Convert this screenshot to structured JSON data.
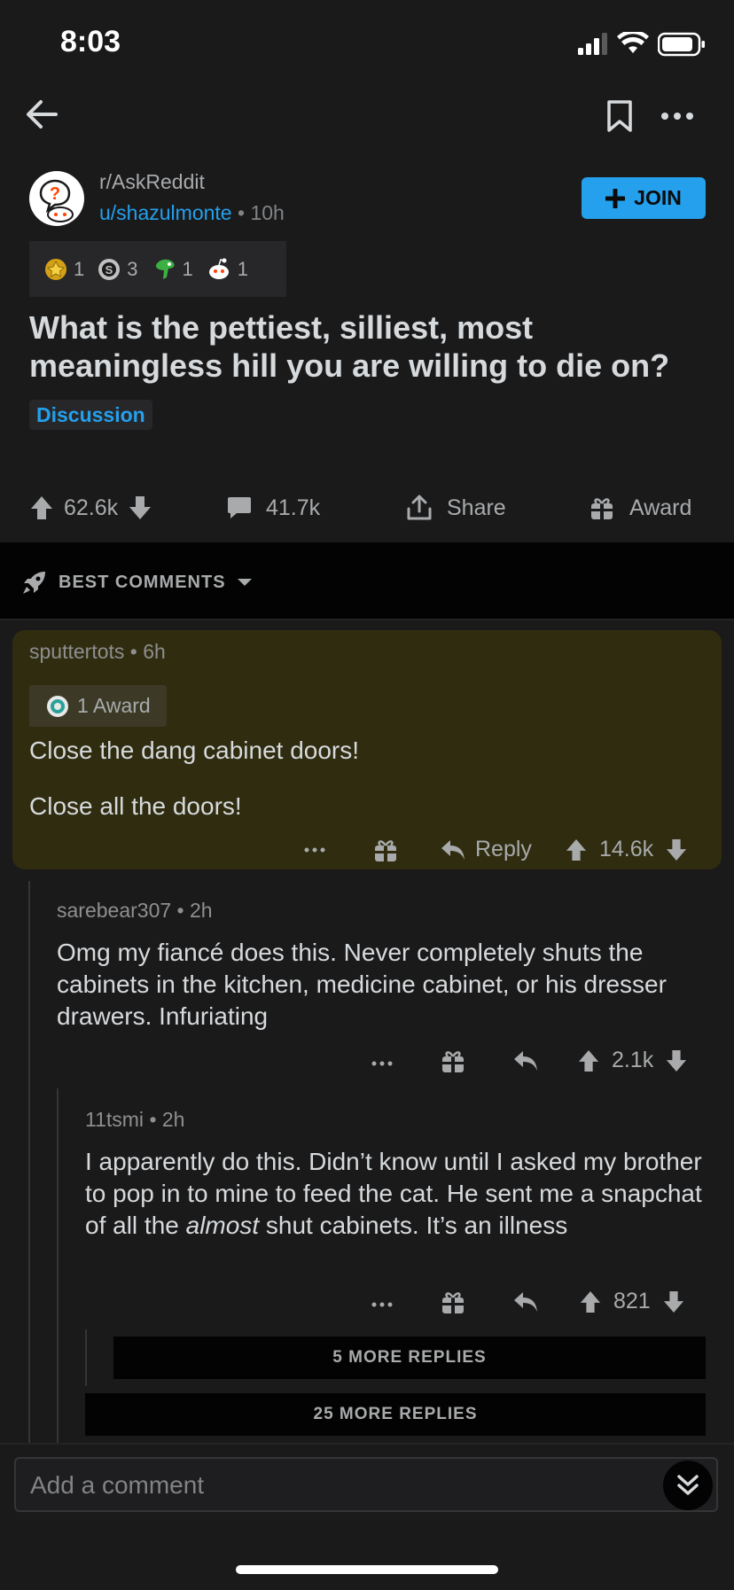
{
  "status_bar": {
    "time": "8:03"
  },
  "post": {
    "subreddit": "r/AskReddit",
    "author": "u/shazulmonte",
    "age": "10h",
    "join_label": "JOIN",
    "awards": [
      {
        "icon": "gold-award-icon",
        "count": "1"
      },
      {
        "icon": "silver-award-icon",
        "count": "3"
      },
      {
        "icon": "dragon-award-icon",
        "count": "1"
      },
      {
        "icon": "snoo-award-icon",
        "count": "1"
      }
    ],
    "title": "What is the pettiest, silliest, most meaningless hill you are willing to die on?",
    "flair": "Discussion",
    "votes": "62.6k",
    "comments": "41.7k",
    "share_label": "Share",
    "award_label": "Award"
  },
  "sort": {
    "label": "BEST COMMENTS"
  },
  "comments": [
    {
      "author": "sputtertots",
      "age": "6h",
      "award_label": "1 Award",
      "paragraphs": [
        "Close the dang cabinet doors!",
        "Close all the doors!"
      ],
      "reply_label": "Reply",
      "votes": "14.6k"
    },
    {
      "author": "sarebear307",
      "age": "2h",
      "body": "Omg my fiancé does this. Never completely shuts the cabinets in the kitchen, medicine cabinet, or his dresser drawers. Infuriating",
      "votes": "2.1k"
    },
    {
      "author": "11tsmi",
      "age": "2h",
      "body_before": "I apparently do this. Didn’t know until I asked my brother to pop in to mine to feed the cat. He sent me a snapchat of all the ",
      "body_em": "almost",
      "body_after": " shut cabinets. It’s an illness",
      "votes": "821"
    }
  ],
  "more_replies": [
    "5 MORE REPLIES",
    "25 MORE REPLIES"
  ],
  "composer": {
    "placeholder": "Add a comment"
  },
  "colors": {
    "accent": "#24a0ed",
    "highlight": "#2f2c10",
    "background": "#1a1a1b"
  }
}
